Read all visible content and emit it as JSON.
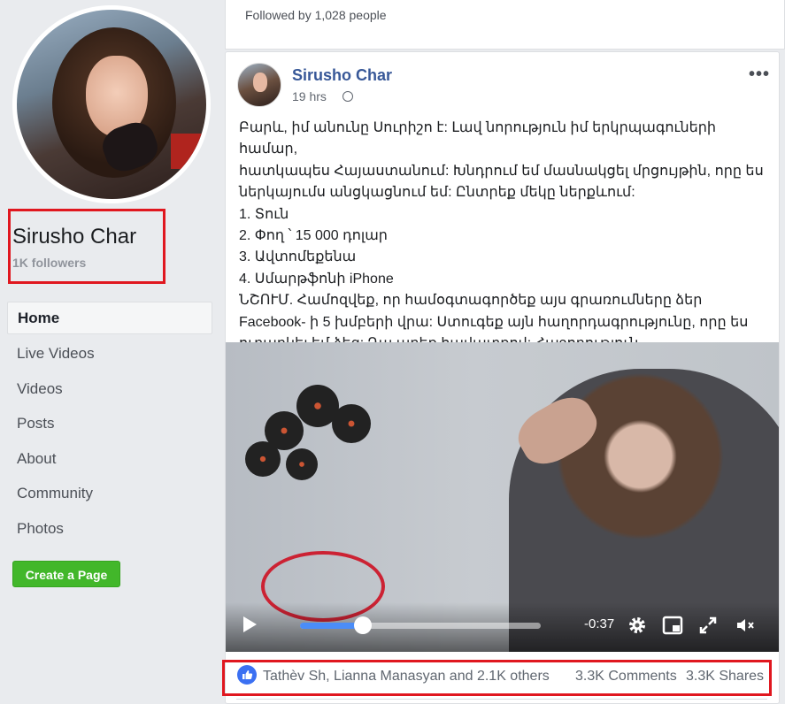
{
  "sidebar": {
    "page_name": "Sirusho Char",
    "followers": "1K followers",
    "nav": [
      "Home",
      "Live Videos",
      "Videos",
      "Posts",
      "About",
      "Community",
      "Photos"
    ],
    "create_button": "Create a Page"
  },
  "top_card": {
    "followed_by": "Followed by 1,028 people"
  },
  "post": {
    "author": "Sirusho Char",
    "time": "19 hrs",
    "more": "•••",
    "text_lines": [
      "Բարև, իմ անունը Սուրիշո է: Լավ նորություն իմ երկրպագուների համար,",
      "հատկապես Հայաստանում: Խնդրում եմ մասնակցել մրցույթին, որը ես",
      "ներկայումս անցկացնում եմ: Ընտրեք մեկը ներքևում:",
      "1. Տուն",
      "2. Փող ՝ 15 000 դոլար",
      "3. Ավտոմեքենա",
      "4. Սմարթֆոնի iPhone",
      "ՆՇՈՒՄ. Համոզվեք, որ համօգտագործեք այս գրառումները ձեր",
      "Facebook- ի 5 խմբերի վրա: Ստուգեք այն հաղորդագրությունը, որը ես",
      "ուղարկել եմ ձեզ: Դա արեք հավատքով: Հաջողություն."
    ],
    "video": {
      "time_remaining": "-0:37",
      "progress": 0.26
    },
    "engagement": {
      "likes": "Tathèv Sh, Lianna Manasyan and 2.1K others",
      "comments": "3.3K Comments",
      "shares": "3.3K Shares"
    }
  }
}
